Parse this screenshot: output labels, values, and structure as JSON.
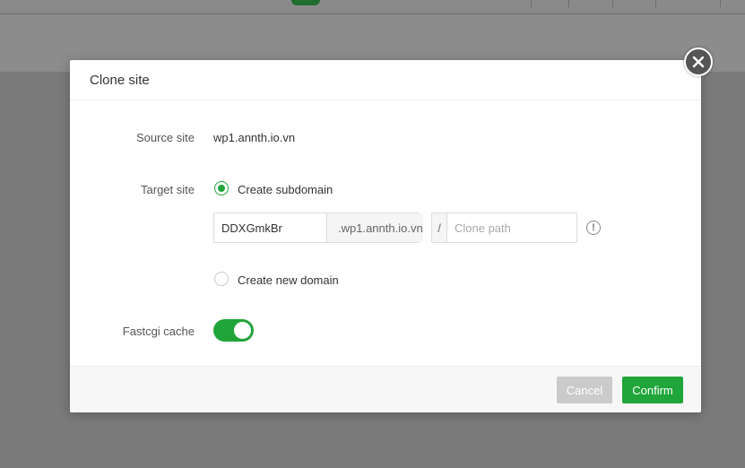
{
  "dialog": {
    "title": "Clone site",
    "source_site_label": "Source site",
    "source_site_value": "wp1.annth.io.vn",
    "target_site_label": "Target site",
    "option_subdomain": "Create subdomain",
    "option_new_domain": "Create new domain",
    "selected_option": "Create subdomain",
    "subdomain_value": "DDXGmkBr",
    "domain_suffix": ".wp1.annth.io.vn",
    "path_prefix": "/",
    "clone_path_placeholder": "Clone path",
    "help_icon": "!",
    "fastcgi_label": "Fastcgi cache",
    "fastcgi_enabled": true,
    "cancel_label": "Cancel",
    "confirm_label": "Confirm"
  },
  "colors": {
    "accent": "#20a53a",
    "overlay": "#7a7a7a",
    "cancel_bg": "#cbcbcb"
  },
  "icons": {
    "close": "close-icon",
    "help": "info-icon"
  }
}
